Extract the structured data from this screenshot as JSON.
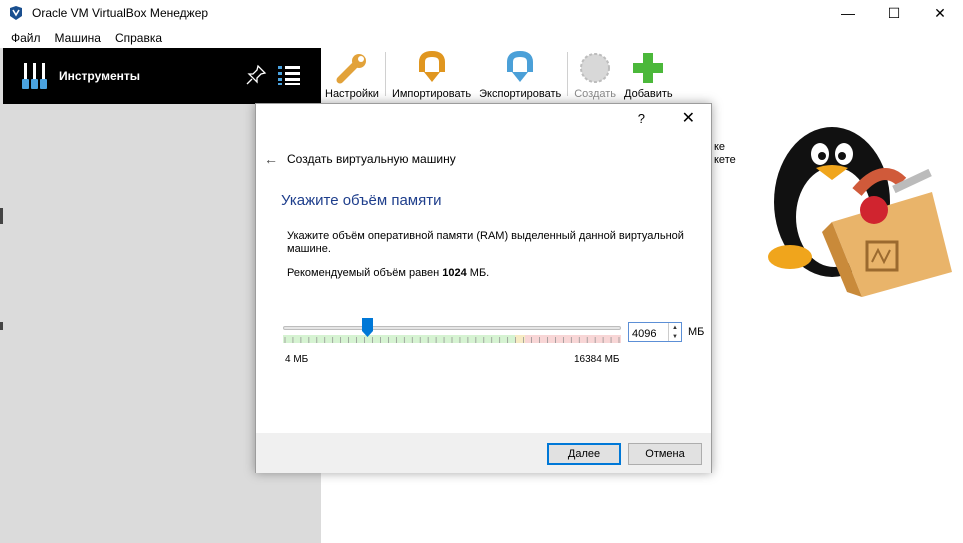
{
  "window": {
    "title": "Oracle VM VirtualBox Менеджер",
    "minimize": "—",
    "maximize": "☐",
    "close": "✕"
  },
  "menu": [
    "Файл",
    "Машина",
    "Справка"
  ],
  "tools": {
    "label": "Инструменты"
  },
  "toolbar": {
    "settings": "Настройки",
    "import": "Импортировать",
    "export": "Экспортировать",
    "create": "Создать",
    "add": "Добавить"
  },
  "welcome_fragments": [
    "ке",
    "кете"
  ],
  "dialog": {
    "help": "?",
    "close": "✕",
    "back": "←",
    "title": "Создать виртуальную машину",
    "section_title": "Укажите объём памяти",
    "description": "Укажите объём оперативной памяти (RAM) выделенный данной виртуальной машине.",
    "recommend_prefix": "Рекомендуемый объём равен ",
    "recommend_value": "1024",
    "recommend_suffix": " МБ.",
    "memory": {
      "value": "4096",
      "unit": "МБ",
      "min_label": "4 МБ",
      "max_label": "16384 МБ",
      "min": 4,
      "max": 16384,
      "current": 4096
    },
    "next_button": "Далее",
    "cancel_button": "Отмена"
  },
  "colors": {
    "tools_bg": "#000000",
    "section_title": "#1e3e8c",
    "accent": "#0078d7",
    "left_panel": "#dbdbdb"
  }
}
